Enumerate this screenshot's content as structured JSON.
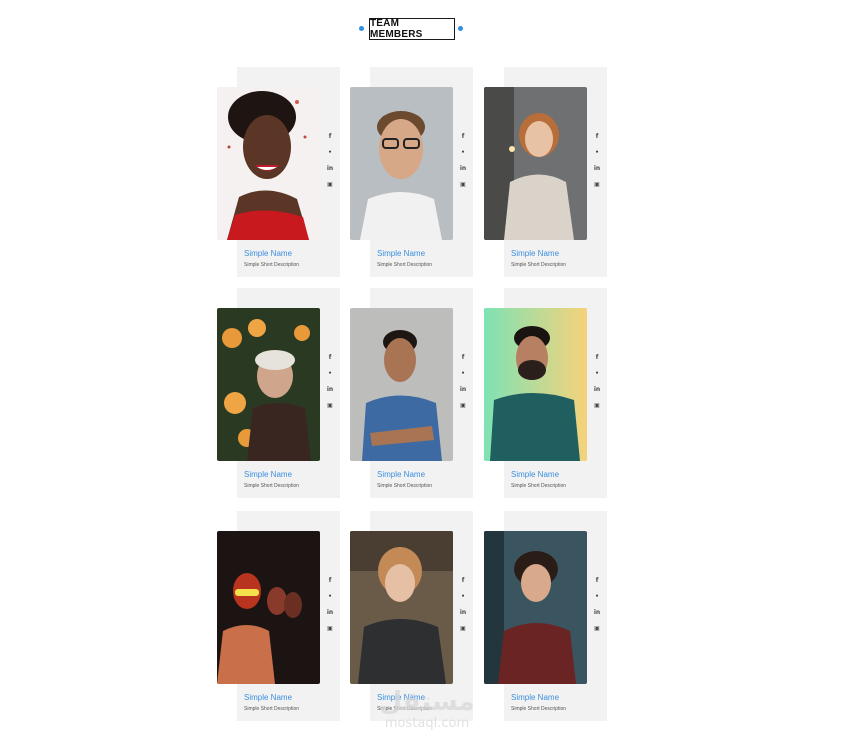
{
  "header": {
    "title": "TEAM MEMBERS"
  },
  "social_icons": [
    "facebook-icon",
    "twitter-icon",
    "linkedin-icon",
    "youtube-icon"
  ],
  "social_glyphs": [
    "f",
    "•",
    "in",
    "▣"
  ],
  "accent_color": "#3b8fe0",
  "members": [
    {
      "name": "Simple Name",
      "description": "Simple Short Description"
    },
    {
      "name": "Simple Name",
      "description": "Simple Short Description"
    },
    {
      "name": "Simple Name",
      "description": "Simple Short Description"
    },
    {
      "name": "Simple Name",
      "description": "Simple Short Description"
    },
    {
      "name": "Simple Name",
      "description": "Simple Short Description"
    },
    {
      "name": "Simple Name",
      "description": "Simple Short Description"
    },
    {
      "name": "Simple Name",
      "description": "Simple Short Description"
    },
    {
      "name": "Simple Name",
      "description": "Simple Short Description"
    },
    {
      "name": "Simple Name",
      "description": "Simple Short Description"
    }
  ],
  "watermark": {
    "arabic": "مستقل",
    "latin": "mostaql.com"
  }
}
